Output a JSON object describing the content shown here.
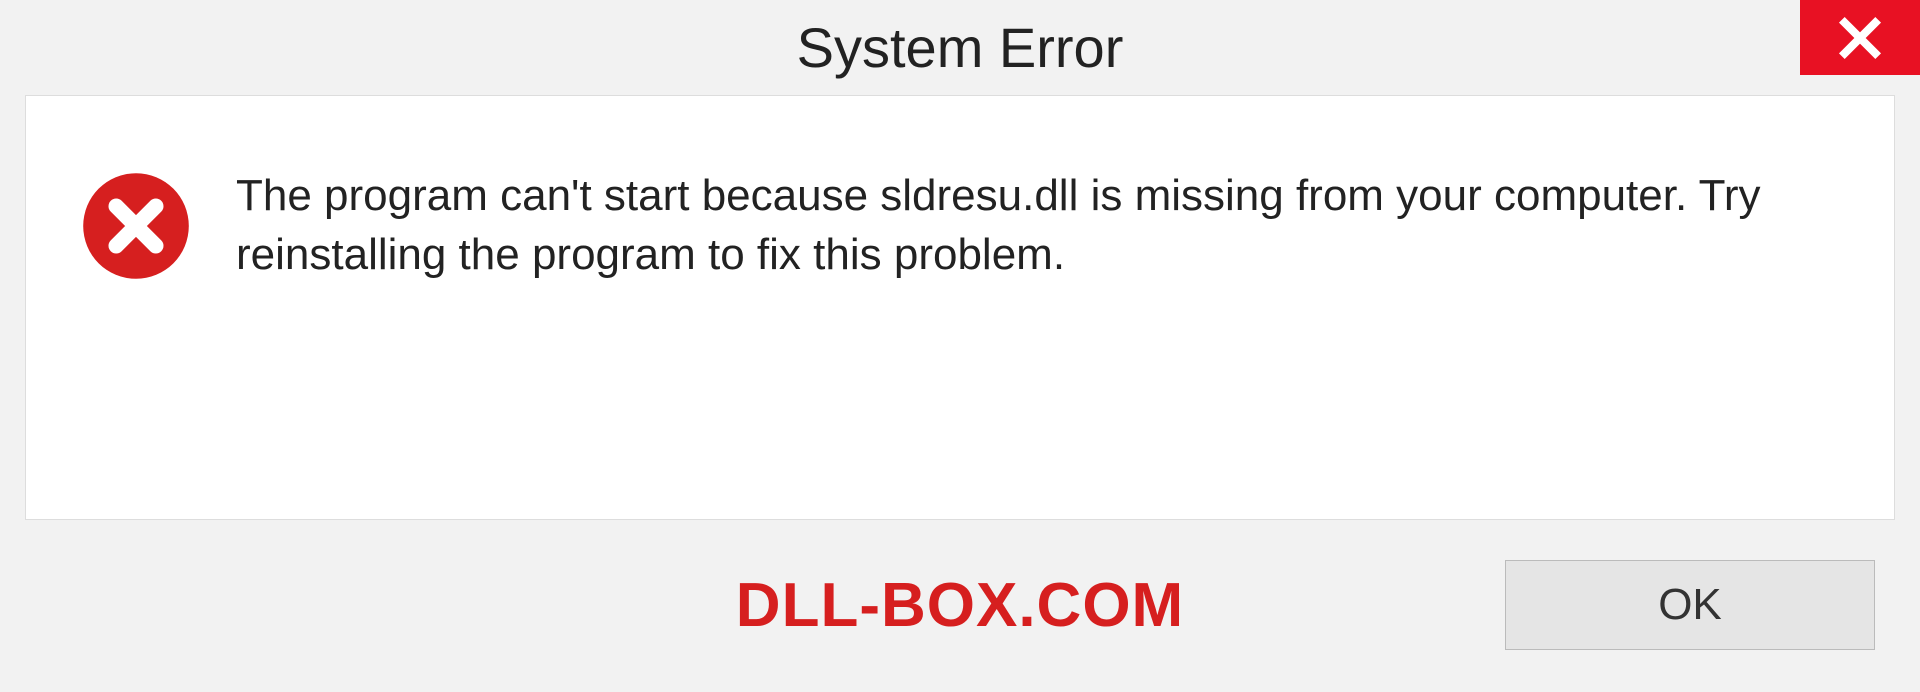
{
  "titlebar": {
    "title": "System Error",
    "close_icon": "close-icon"
  },
  "body": {
    "error_icon": "error-circle-x-icon",
    "message": "The program can't start because sldresu.dll is missing from your computer. Try reinstalling the program to fix this problem."
  },
  "footer": {
    "watermark": "DLL-BOX.COM",
    "ok_label": "OK"
  },
  "colors": {
    "close_bg": "#e81123",
    "error_icon": "#d61f1f",
    "watermark": "#d61f1f"
  }
}
